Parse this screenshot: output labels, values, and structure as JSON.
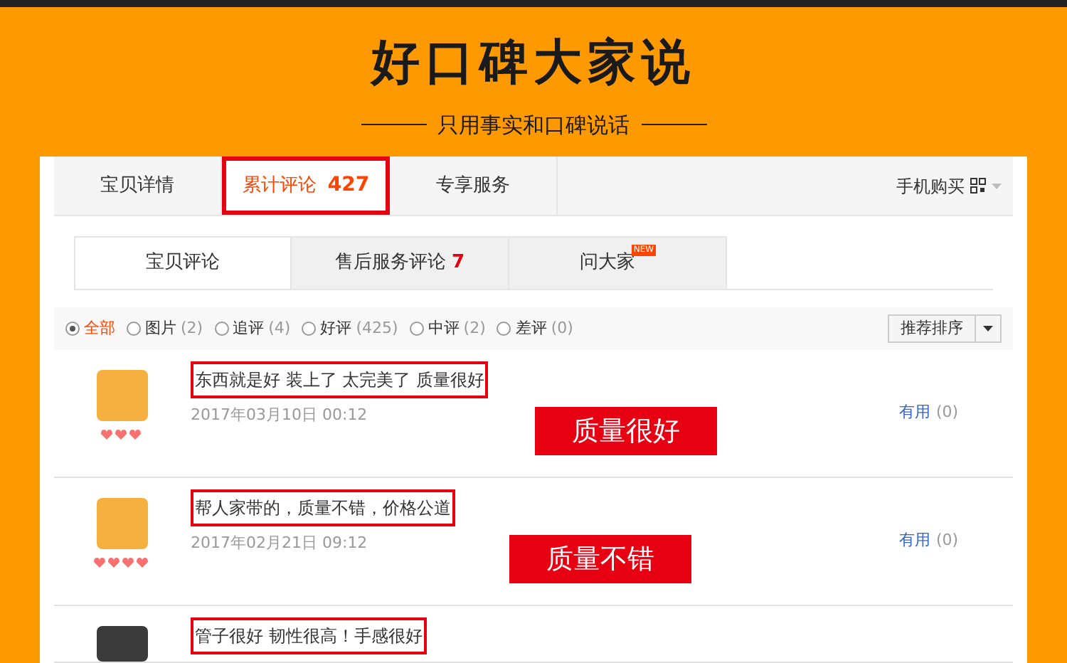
{
  "banner": {
    "title": "好口碑大家说",
    "subtitle": "只用事实和口碑说话"
  },
  "tabs": [
    {
      "label": "宝贝详情",
      "selected": false
    },
    {
      "label": "累计评论",
      "count": "427",
      "selected": true
    },
    {
      "label": "专享服务",
      "selected": false
    }
  ],
  "mobile_buy": "手机购买",
  "sub_tabs": [
    {
      "label": "宝贝评论",
      "selected": true
    },
    {
      "label": "售后服务评论",
      "count": "7",
      "selected": false
    },
    {
      "label": "问大家",
      "badge": "NEW",
      "selected": false
    }
  ],
  "filters": [
    {
      "label": "全部",
      "selected": true
    },
    {
      "label": "图片",
      "count": "(2)",
      "selected": false
    },
    {
      "label": "追评",
      "count": "(4)",
      "selected": false
    },
    {
      "label": "好评",
      "count": "(425)",
      "selected": false
    },
    {
      "label": "中评",
      "count": "(2)",
      "selected": false
    },
    {
      "label": "差评",
      "count": "(0)",
      "selected": false
    }
  ],
  "sort": "推荐排序",
  "reviews": [
    {
      "kind": "cartoon",
      "text": "东西就是好 装上了 太完美了 质量很好",
      "date": "2017年03月10日 00:12",
      "useful": "有用",
      "useful_count": "(0)",
      "highlight": "质量很好"
    },
    {
      "kind": "cartoon",
      "text": "帮人家带的，质量不错，价格公道",
      "date": "2017年02月21日 09:12",
      "useful": "有用",
      "useful_count": "(0)",
      "highlight": "质量不错"
    },
    {
      "kind": "dark",
      "text": "管子很好 韧性很高！手感很好"
    }
  ]
}
